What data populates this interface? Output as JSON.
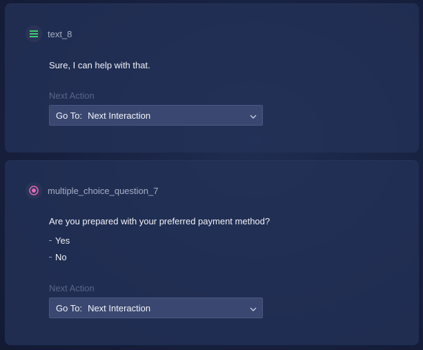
{
  "cards": [
    {
      "name": "text_8",
      "icon": "text-lines-icon",
      "icon_color": "#3ecf73",
      "message": "Sure, I can help with that.",
      "next_action_label": "Next Action",
      "select_prefix": "Go To:",
      "select_value": "Next Interaction"
    },
    {
      "name": "multiple_choice_question_7",
      "icon": "radio-icon",
      "icon_color": "#e06ab8",
      "question": "Are you prepared with your preferred payment method?",
      "options": [
        "Yes",
        "No"
      ],
      "next_action_label": "Next Action",
      "select_prefix": "Go To:",
      "select_value": "Next Interaction"
    }
  ]
}
